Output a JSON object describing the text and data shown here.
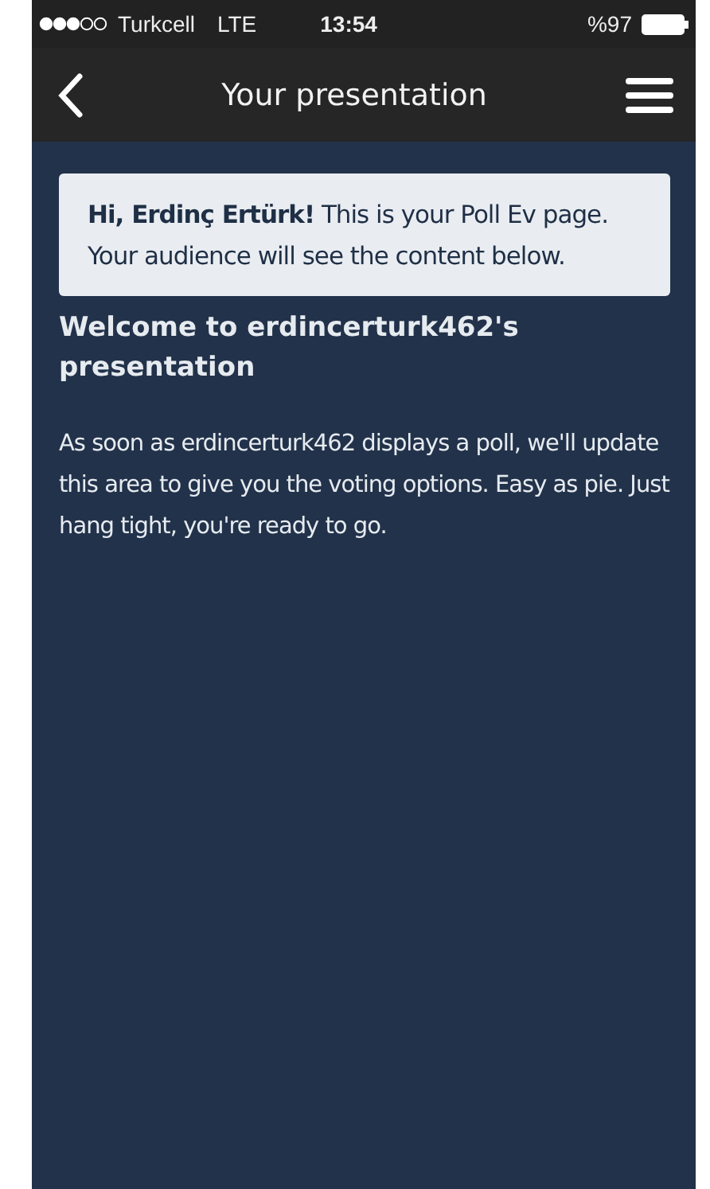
{
  "status_bar": {
    "carrier": "Turkcell",
    "network": "LTE",
    "time": "13:54",
    "battery": "%97"
  },
  "nav": {
    "title": "Your presentation"
  },
  "notice": "**Hi, Erdinç Ertürk!** This is your Poll Ev page. Your audience will see the content below.",
  "heading": "Welcome to erdincerturk462's presentation",
  "message": "As soon as erdincerturk462 displays a poll, we'll update this area to give you the voting options. Easy as pie. Just hang tight, you're ready to go."
}
